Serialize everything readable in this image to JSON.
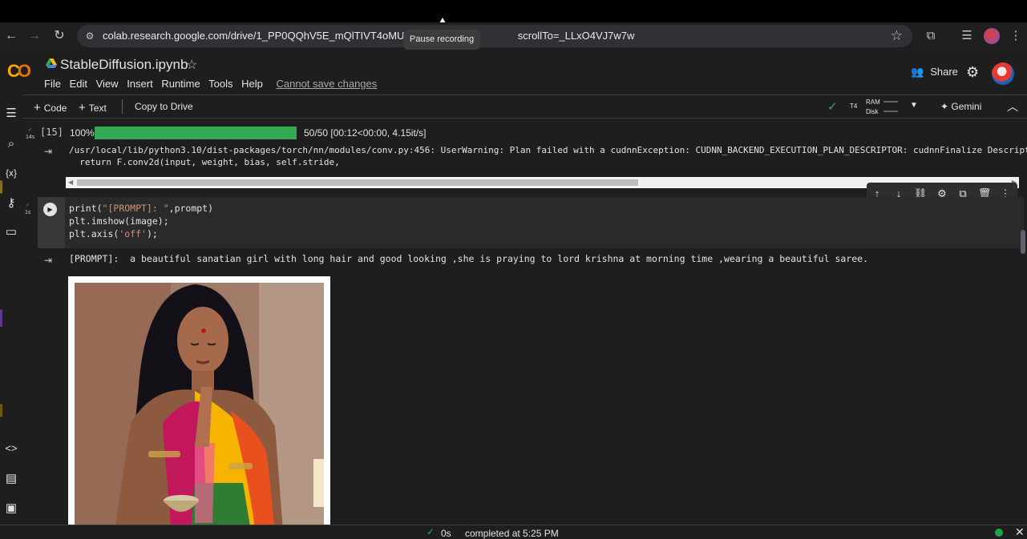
{
  "browser": {
    "url_main": "colab.research.google.com/drive/1_PP0QQhV5E_mQlTIVT4oMU3M7lrS7j",
    "url_tail": "scrollTo=_LLxO4VJ7w7w",
    "tooltip": "Pause recording"
  },
  "header": {
    "title": "StableDiffusion.ipynb",
    "share_label": "Share",
    "menu": [
      "File",
      "Edit",
      "View",
      "Insert",
      "Runtime",
      "Tools",
      "Help"
    ],
    "cannot_save": "Cannot save changes"
  },
  "toolbar": {
    "code_label": "Code",
    "text_label": "Text",
    "copy_drive": "Copy to Drive",
    "gpu": "T4",
    "ram": "RAM",
    "disk": "Disk",
    "gemini": "Gemini"
  },
  "cell1": {
    "exec_count": "[15]",
    "exec_time": "14s",
    "progress_pct": "100%",
    "progress_value": 1.0,
    "progress_stats": "50/50 [00:12<00:00,   4.15it/s]",
    "warning_line1": "/usr/local/lib/python3.10/dist-packages/torch/nn/modules/conv.py:456: UserWarning: Plan failed with a cudnnException: CUDNN_BACKEND_EXECUTION_PLAN_DESCRIPTOR: cudnnFinalize Descriptor",
    "warning_line2": "  return F.conv2d(input, weight, bias, self.stride,"
  },
  "cell2": {
    "exec_time": "1s",
    "code_line1_a": "print(",
    "code_line1_str": "\"[PROMPT]: \"",
    "code_line1_b": ",prompt)",
    "code_line2": "plt.imshow(image);",
    "code_line3_a": "plt.axis(",
    "code_line3_str": "'off'",
    "code_line3_b": ");",
    "output_text": "[PROMPT]:  a beautiful sanatian girl with long hair and good looking ,she is praying to lord krishna at morning time ,wearing a beautiful saree."
  },
  "status": {
    "time": "0s",
    "completed": "completed at 5:25 PM"
  },
  "colors": {
    "accent_green": "#34a853",
    "colab_orange": "#f9ab00"
  }
}
